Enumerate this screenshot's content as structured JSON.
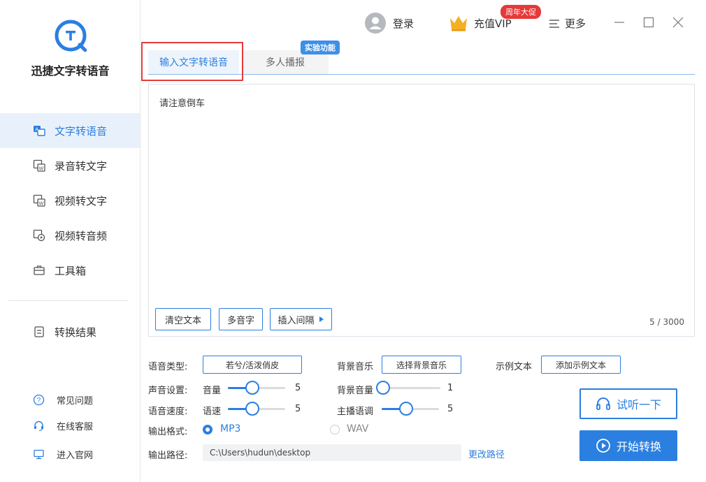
{
  "app": {
    "title": "迅捷文字转语音"
  },
  "sidebar": {
    "items": [
      {
        "label": "文字转语音",
        "icon": "text-to-speech-icon"
      },
      {
        "label": "录音转文字",
        "icon": "audio-to-text-icon"
      },
      {
        "label": "视频转文字",
        "icon": "video-to-text-icon"
      },
      {
        "label": "视频转音频",
        "icon": "video-to-audio-icon"
      },
      {
        "label": "工具箱",
        "icon": "toolbox-icon"
      }
    ],
    "results": {
      "label": "转换结果",
      "icon": "result-icon"
    },
    "links": [
      {
        "label": "常见问题",
        "icon": "help-icon"
      },
      {
        "label": "在线客服",
        "icon": "headset-icon"
      },
      {
        "label": "进入官网",
        "icon": "monitor-icon"
      }
    ]
  },
  "topbar": {
    "login": "登录",
    "vip": "充值VIP",
    "vip_badge": "周年大促",
    "more": "更多"
  },
  "tabs": {
    "input": "输入文字转语音",
    "multi": "多人播报",
    "exp_badge": "实验功能"
  },
  "editor": {
    "text": "请注意倒车",
    "clear": "清空文本",
    "polyphone": "多音字",
    "insert_pause": "插入间隔",
    "count": "5 / 3000"
  },
  "settings": {
    "voice_type_label": "语音类型:",
    "voice_type_value": "若兮/活泼俏皮",
    "bgm_label": "背景音乐",
    "bgm_button": "选择背景音乐",
    "sample_label": "示例文本",
    "sample_button": "添加示例文本",
    "sound_label": "声音设置:",
    "volume_label": "音量",
    "volume_value": "5",
    "bg_volume_label": "背景音量",
    "bg_volume_value": "1",
    "speed_label": "语音速度:",
    "rate_label": "语速",
    "rate_value": "5",
    "pitch_label": "主播语调",
    "pitch_value": "5",
    "format_label": "输出格式:",
    "format_mp3": "MP3",
    "format_wav": "WAV",
    "selected_format": "MP3",
    "path_label": "输出路径:",
    "path_value": "C:\\Users\\hudun\\desktop",
    "change_path": "更改路径",
    "listen": "试听一下",
    "start": "开始转换",
    "levels": {
      "volume": 0.43,
      "bg_volume": 0.0,
      "rate": 0.43,
      "pitch": 0.43
    }
  },
  "colors": {
    "accent": "#2b7fe0",
    "badge_red": "#e5393a",
    "highlight": "#e23c3c"
  }
}
